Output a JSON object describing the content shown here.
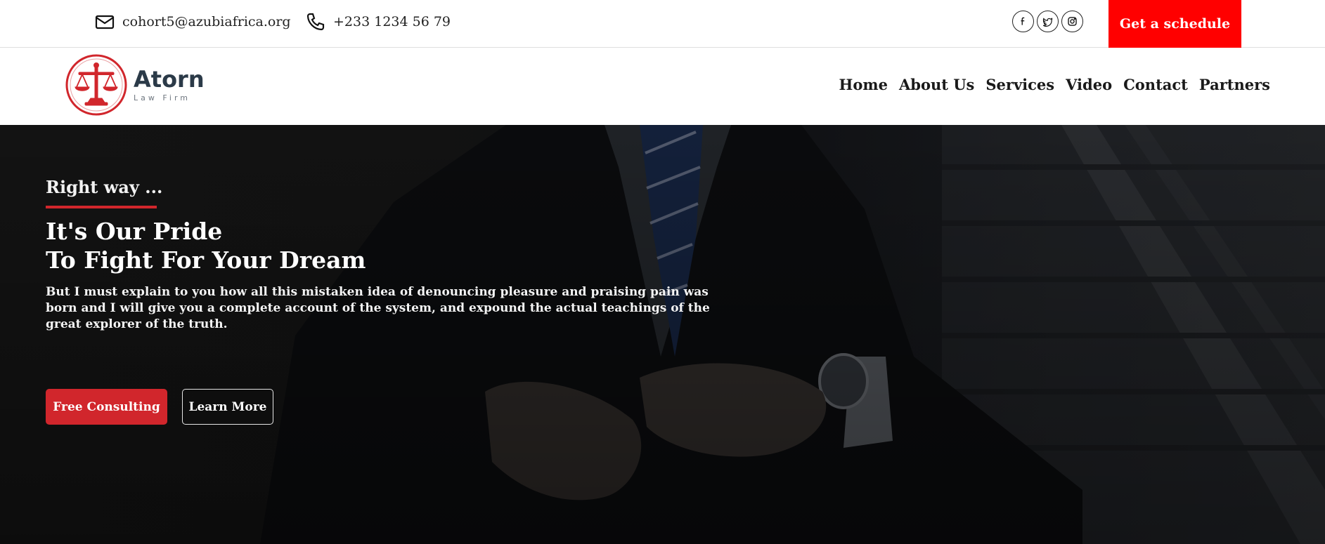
{
  "topbar": {
    "email": "cohort5@azubiafrica.org",
    "phone": "+233 1234 56 79",
    "socials": [
      "facebook-icon",
      "twitter-icon",
      "instagram-icon"
    ],
    "schedule_label": "Get a schedule"
  },
  "brand": {
    "name": "Atorn",
    "tagline": "Law Firm"
  },
  "nav": {
    "items": [
      "Home",
      "About Us",
      "Services",
      "Video",
      "Contact",
      "Partners"
    ]
  },
  "hero": {
    "kicker": "Right way ...",
    "headline_1": "It's Our Pride",
    "headline_2": "To Fight For Your Dream",
    "paragraph": "But I must explain to you how all this mistaken idea of denouncing pleasure and praising pain was born and I will give you a complete account of the system, and expound the actual teachings of the great explorer of the truth.",
    "primary_button": "Free Consulting",
    "secondary_button": "Learn More"
  },
  "colors": {
    "accent_red": "#ff0000",
    "button_red": "#d1262c",
    "dark_text": "#1a1a1a",
    "logo_red": "#d1262c",
    "logo_navy": "#2b3a48"
  }
}
